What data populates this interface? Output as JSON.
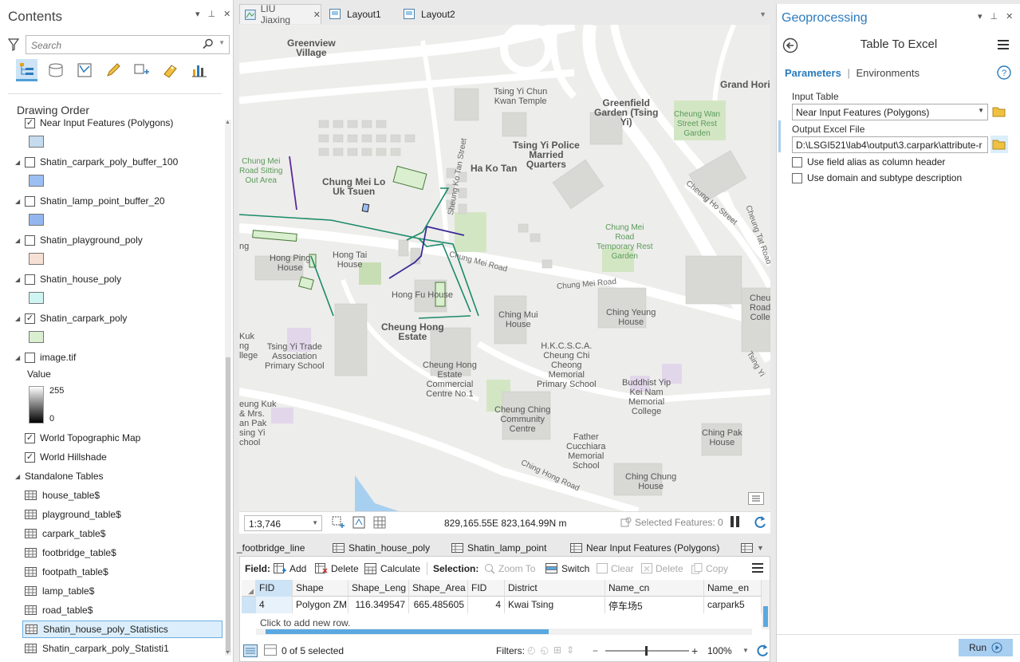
{
  "contents": {
    "title": "Contents",
    "search_placeholder": "Search",
    "drawing_order": "Drawing Order",
    "layers": [
      {
        "name": "Near Input Features (Polygons)",
        "checked": true,
        "swatch": "#c5dbee"
      },
      {
        "name": "Shatin_carpark_poly_buffer_100",
        "checked": false,
        "swatch": "#9bbff3"
      },
      {
        "name": "Shatin_lamp_point_buffer_20",
        "checked": false,
        "swatch": "#93b6ee"
      },
      {
        "name": "Shatin_playground_poly",
        "checked": false,
        "swatch": "#f6e0d4"
      },
      {
        "name": "Shatin_house_poly",
        "checked": false,
        "swatch": "#cff5f2"
      },
      {
        "name": "Shatin_carpark_poly",
        "checked": true,
        "swatch": "#d9efcf"
      },
      {
        "name": "image.tif",
        "checked": false,
        "swatch": ""
      }
    ],
    "raster_value_label": "Value",
    "raster_max": "255",
    "raster_min": "0",
    "basemaps": [
      {
        "name": "World Topographic Map",
        "checked": true
      },
      {
        "name": "World Hillshade",
        "checked": true
      }
    ],
    "standalone_label": "Standalone Tables",
    "tables": [
      "house_table$",
      "playground_table$",
      "carpark_table$",
      "footbridge_table$",
      "footpath_table$",
      "lamp_table$",
      "road_table$",
      "Shatin_house_poly_Statistics",
      "Shatin_carpark_poly_Statisti1"
    ],
    "selected_table_index": 7
  },
  "tabs": [
    {
      "label": "LIU Jiaxing",
      "active": true
    },
    {
      "label": "Layout1",
      "active": false
    },
    {
      "label": "Layout2",
      "active": false
    }
  ],
  "map": {
    "labels": {
      "greenview": "Greenview\nVillage",
      "tsing_yi_chun": "Tsing Yi Chun\nKwan Temple",
      "greenfield": "Greenfield\nGarden (Tsing\nYi)",
      "grand_hori": "Grand Hori",
      "cheung_wan": "Cheung Wan\nStreet Rest\nGarden",
      "chung_mei_lo": "Chung Mei Lo\nUk Tsuen",
      "tsing_yi_police": "Tsing Yi Police\nMarried\nQuarters",
      "ha_ko_tan": "Ha Ko Tan",
      "chung_mei_sitting": "Chung Mei\nRoad Sitting\nOut Area",
      "hong_ping": "Hong Ping\nHouse",
      "hong_tai": "Hong Tai\nHouse",
      "chung_mei_temp": "Chung Mei\nRoad\nTemporary Rest\nGarden",
      "hong_fu": "Hong Fu House",
      "cheung_hong_estate": "Cheung Hong\nEstate",
      "ching_mui": "Ching Mui\nHouse",
      "ching_yeung": "Ching Yeung\nHouse",
      "cheu_road": "Cheu\nRoad\nColle",
      "tsing_yi_trade": "Tsing Yi Trade\nAssociation\nPrimary School",
      "kuk_college": "Kuk\nng\nllege",
      "hkcsca": "H.K.C.S.C.A.\nCheung Chi\nCheong\nMemorial\nPrimary School",
      "cheung_hong_commercial": "Cheung Hong\nEstate\nCommercial\nCentre No.1",
      "buddhist": "Buddhist Yip\nKei Nam\nMemorial\nCollege",
      "ching_pak": "Ching Pak\nHouse",
      "cheung_ching": "Cheung Ching\nCommunity\nCentre",
      "eung_kuk": "eung Kuk\n& Mrs.\nan Pak\nsing Yi\nchool",
      "father": "Father\nCucchiara\nMemorial\nSchool",
      "ching_chung": "Ching Chung\nHouse",
      "ng": "ng"
    },
    "roads": {
      "sheung_ko_tan": "Sheung Ko Tan Street",
      "chung_mei_road1": "Chung Mei Road",
      "chung_mei_road2": "Chung Mei Road",
      "cheung_ho": "Cheung Ho Street",
      "cheung_tat": "Cheung Tat Road",
      "ching_hong": "Ching Hong Road",
      "tsing_yi": "Tsing Yi"
    }
  },
  "map_status": {
    "scale": "1:3,746",
    "coords": "829,165.55E 823,164.99N m",
    "selected_features": "Selected Features: 0"
  },
  "attr_tabs": [
    "_footbridge_line",
    "Shatin_house_poly",
    "Shatin_lamp_point",
    "Near Input Features (Polygons)"
  ],
  "attr_toolbar": {
    "field_label": "Field:",
    "add": "Add",
    "delete": "Delete",
    "calculate": "Calculate",
    "selection_label": "Selection:",
    "zoom_to": "Zoom To",
    "switch": "Switch",
    "clear": "Clear",
    "delete2": "Delete",
    "copy": "Copy"
  },
  "grid": {
    "columns": [
      "FID",
      "Shape",
      "Shape_Leng",
      "Shape_Area",
      "FID",
      "District",
      "Name_cn",
      "Name_en"
    ],
    "rows": [
      [
        "4",
        "Polygon ZM",
        "116.349547",
        "665.485605",
        "4",
        "Kwai Tsing",
        "停车场5",
        "carpark5"
      ]
    ],
    "add_row_text": "Click to add new row."
  },
  "attr_status": {
    "selected_text": "0 of 5 selected",
    "filters_label": "Filters:",
    "zoom": "100%"
  },
  "geo": {
    "title": "Geoprocessing",
    "tool_name": "Table To Excel",
    "tab_parameters": "Parameters",
    "tab_environments": "Environments",
    "input_table_label": "Input Table",
    "input_table_value": "Near Input Features (Polygons)",
    "output_label": "Output Excel File",
    "output_value": "D:\\LSGI521\\lab4\\output\\3.carpark\\attribute-r",
    "opt1": "Use field alias as column header",
    "opt2": "Use domain and subtype description",
    "run": "Run"
  }
}
